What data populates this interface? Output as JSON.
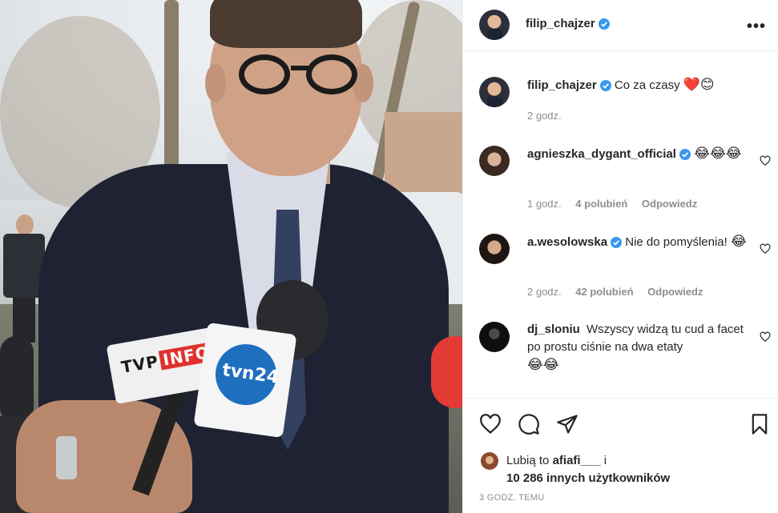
{
  "post": {
    "author": "filip_chajzer",
    "author_verified": true,
    "caption_user": "filip_chajzer",
    "caption_text": "Co za czasy",
    "caption_emoji": "❤️😊",
    "caption_time": "2 godz.",
    "more_icon": "more-horizontal-icon"
  },
  "photo": {
    "mic_tvp_brand": "TVP",
    "mic_tvp_info": "INFO",
    "mic_tvn_brand": "tvn24"
  },
  "comments": [
    {
      "user": "agnieszka_dygant_official",
      "verified": true,
      "text": "",
      "emoji": "😂😂😂",
      "time": "1 godz.",
      "likes": "4 polubień",
      "reply": "Odpowiedz"
    },
    {
      "user": "a.wesolowska",
      "verified": true,
      "text": "Nie do pomyślenia!",
      "emoji": "😂",
      "time": "2 godz.",
      "likes": "42 polubień",
      "reply": "Odpowiedz"
    },
    {
      "user": "dj_sloniu",
      "verified": false,
      "text": "Wszyscy widzą tu cud a facet po prostu ciśnie na dwa etaty",
      "emoji": "😂😂",
      "time": "",
      "likes": "",
      "reply": ""
    }
  ],
  "actions": {
    "icons": [
      "heart-icon",
      "comment-icon",
      "share-icon",
      "bookmark-icon"
    ]
  },
  "likes": {
    "prefix": "Lubią to",
    "user": "afiafi___",
    "conj": "i",
    "others": "10 286 innych użytkowników"
  },
  "timestamp": "3 GODZ. TEMU",
  "colors": {
    "verified_blue": "#3897f0",
    "heart_red": "#ed4956",
    "text_primary": "#262626",
    "text_secondary": "#8e8e8e"
  }
}
